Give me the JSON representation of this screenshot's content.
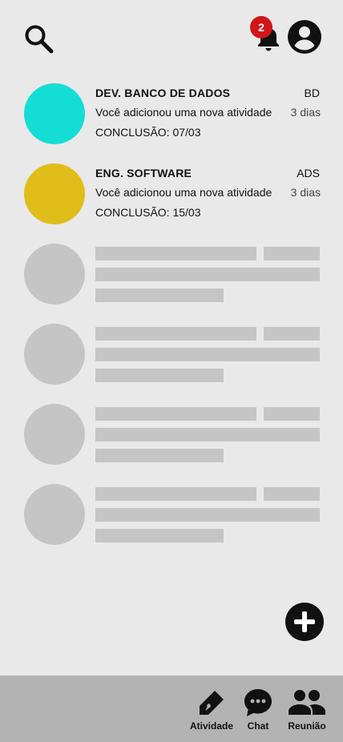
{
  "header": {
    "notification_count": "2"
  },
  "courses": [
    {
      "name": "DEV. BANCO DE DADOS",
      "code": "BD",
      "message": "Você adicionou uma nova atividade",
      "time": "3 dias",
      "due": "CONCLUSÃO: 07/03",
      "color": "#14ddd5"
    },
    {
      "name": "ENG. SOFTWARE",
      "code": "ADS",
      "message": "Você adicionou uma nova atividade",
      "time": "3 dias",
      "due": "CONCLUSÃO: 15/03",
      "color": "#e1bd19"
    }
  ],
  "bottom_nav": {
    "items": [
      {
        "label": "Atividade",
        "icon": "pen-icon"
      },
      {
        "label": "Chat",
        "icon": "chat-icon"
      },
      {
        "label": "Reunião",
        "icon": "people-icon"
      }
    ]
  }
}
